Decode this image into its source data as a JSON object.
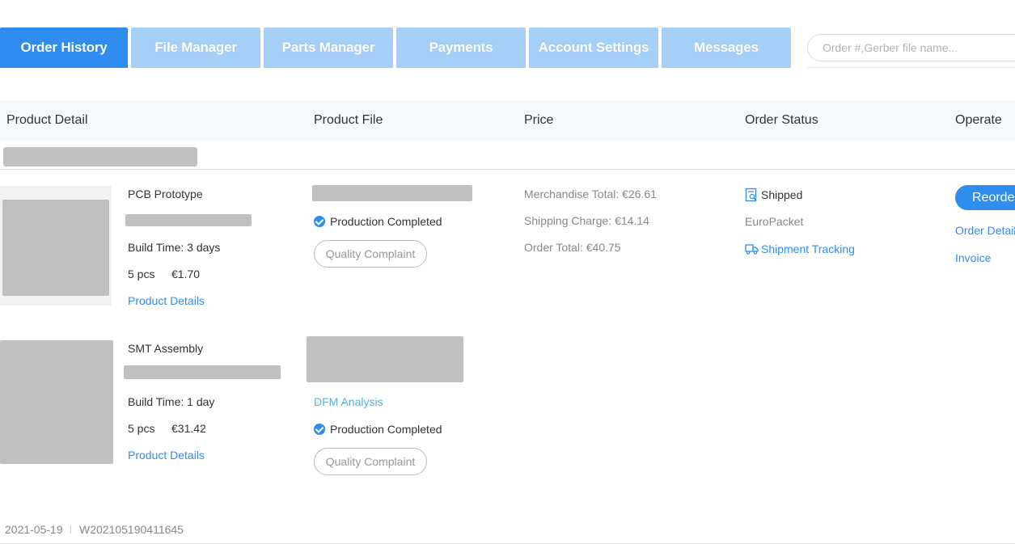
{
  "tabs": [
    {
      "label": "Order History",
      "active": true
    },
    {
      "label": "File Manager",
      "active": false
    },
    {
      "label": "Parts Manager",
      "active": false
    },
    {
      "label": "Payments",
      "active": false
    },
    {
      "label": "Account Settings",
      "active": false
    },
    {
      "label": "Messages",
      "active": false
    }
  ],
  "search": {
    "placeholder": "Order #,Gerber file name...",
    "value": ""
  },
  "table_headers": {
    "product_detail": "Product Detail",
    "product_file": "Product File",
    "price": "Price",
    "order_status": "Order Status",
    "operate": "Operate"
  },
  "items": [
    {
      "name": "PCB Prototype",
      "build_time": "Build Time: 3 days",
      "qty": "5 pcs",
      "price": "€1.70",
      "details_link": "Product Details",
      "production_status": "Production Completed",
      "complaint_button": "Quality Complaint"
    },
    {
      "name": "SMT Assembly",
      "build_time": "Build Time: 1 day",
      "qty": "5 pcs",
      "price": "€31.42",
      "details_link": "Product Details",
      "dfm_link": "DFM Analysis",
      "production_status": "Production Completed",
      "complaint_button": "Quality Complaint"
    }
  ],
  "pricing": {
    "merchandise_total": "Merchandise Total: €26.61",
    "shipping_charge": "Shipping Charge: €14.14",
    "order_total": "Order Total: €40.75"
  },
  "status": {
    "label": "Shipped",
    "carrier": "EuroPacket",
    "tracking_link": "Shipment Tracking"
  },
  "operate": {
    "reorder": "Reorder",
    "order_details": "Order Details",
    "invoice": "Invoice"
  },
  "footer": {
    "date": "2021-05-19",
    "order_number": "W202105190411645"
  },
  "colors": {
    "primary": "#2f8df0",
    "tab_inactive": "#a6cff8",
    "header_bg": "#f6f9fd",
    "redacted": "#c0c0c0"
  },
  "icons": [
    "check-circle-icon",
    "shipped-doc-icon",
    "truck-icon"
  ]
}
